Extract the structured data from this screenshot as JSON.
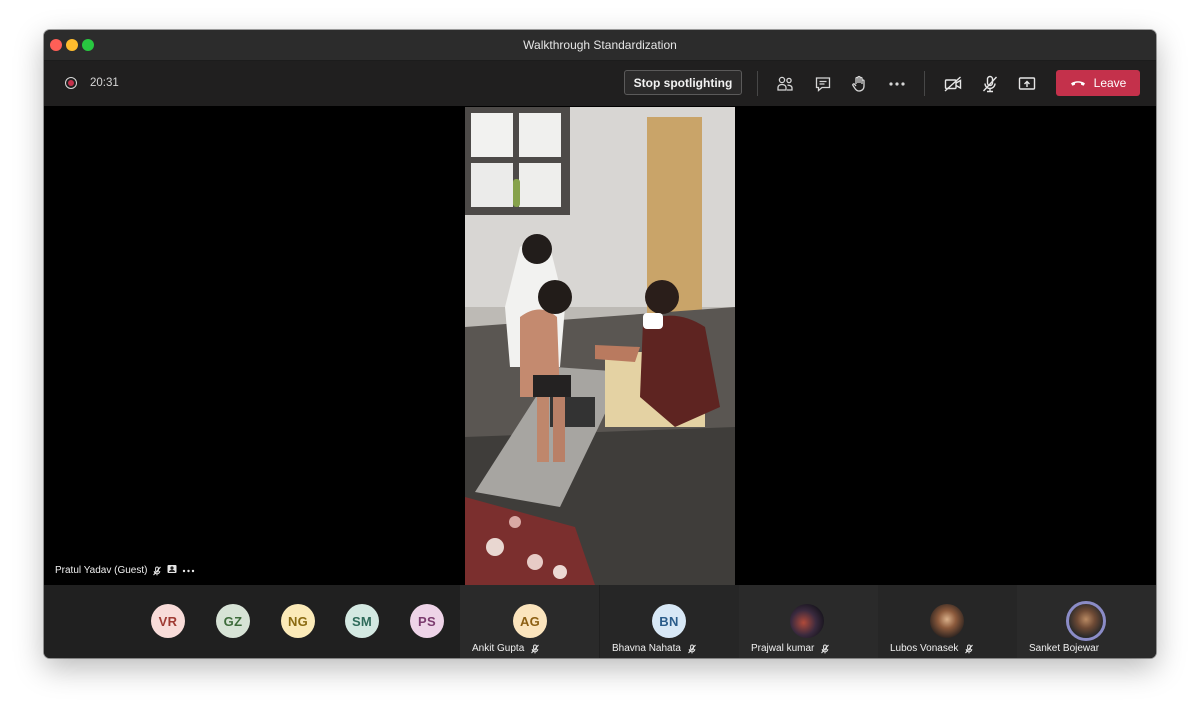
{
  "window": {
    "title": "Walkthrough Standardization"
  },
  "toolbar": {
    "timer": "20:31",
    "stop_spotlight_label": "Stop spotlighting",
    "leave_label": "Leave",
    "icons": [
      "record-icon",
      "participants-icon",
      "chat-icon",
      "raise-hand-icon",
      "more-options-icon",
      "camera-off-icon",
      "mic-off-icon",
      "share-screen-icon",
      "hang-up-icon"
    ]
  },
  "stage": {
    "speaker_name": "Pratul Yadav (Guest)"
  },
  "participants": {
    "avatars": [
      {
        "initials": "VR",
        "bg": "#f8dcd9",
        "fg": "#9f3a33"
      },
      {
        "initials": "GZ",
        "bg": "#d7e3d6",
        "fg": "#3d6b3b"
      },
      {
        "initials": "NG",
        "bg": "#fbeab8",
        "fg": "#8a6a10"
      },
      {
        "initials": "SM",
        "bg": "#d4e9e2",
        "fg": "#2f6b5a"
      },
      {
        "initials": "PS",
        "bg": "#eed4e8",
        "fg": "#7c3b6f"
      }
    ],
    "tiles": [
      {
        "name": "Ankit Gupta",
        "initials": "AG",
        "bg": "#fbe4bd",
        "fg": "#8c5f13"
      },
      {
        "name": "Bhavna Nahata",
        "initials": "BN",
        "bg": "#d8e8f6",
        "fg": "#2b5c8a"
      },
      {
        "name": "Prajwal kumar"
      },
      {
        "name": "Lubos Vonasek"
      },
      {
        "name": "Sanket Bojewar"
      }
    ]
  },
  "colors": {
    "leave": "#c4314b",
    "speaking_ring": "#8b8cc7",
    "toolbar_bg": "#201f1f"
  }
}
